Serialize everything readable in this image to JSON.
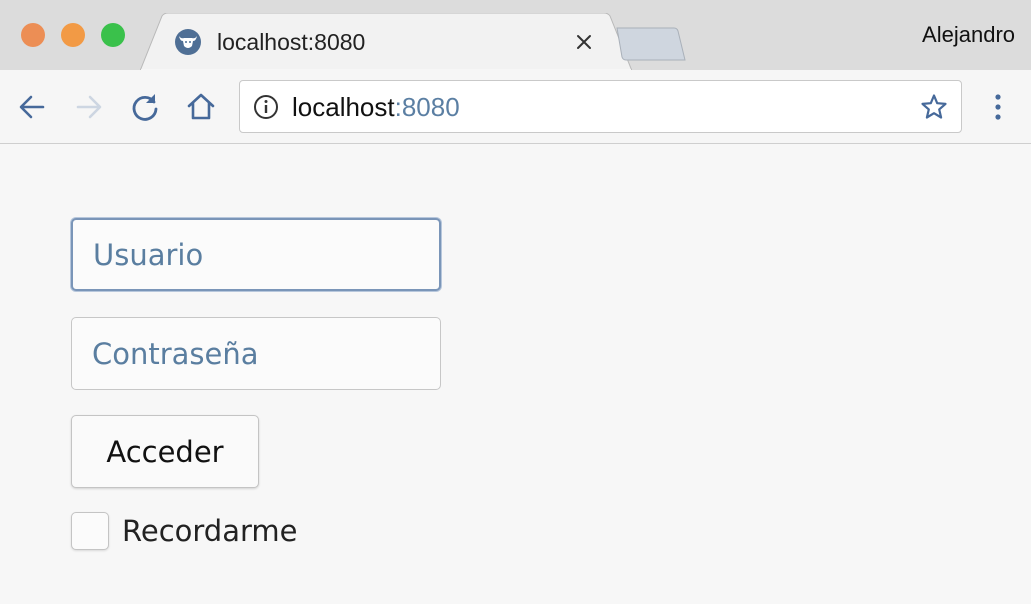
{
  "window": {
    "profile_name": "Alejandro",
    "traffic_lights": {
      "close_color": "#ec8e55",
      "minimize_color": "#f29a45",
      "zoom_color": "#3ac14b"
    }
  },
  "tab": {
    "title": "localhost:8080",
    "favicon": "bull-logo-icon",
    "close_icon": "close-icon"
  },
  "toolbar": {
    "back_icon": "arrow-left-icon",
    "forward_icon": "arrow-right-icon",
    "reload_icon": "reload-icon",
    "home_icon": "home-icon",
    "menu_icon": "more-vertical-icon"
  },
  "omnibox": {
    "info_icon": "info-icon",
    "url_host": "localhost",
    "url_port": ":8080",
    "bookmark_icon": "star-icon"
  },
  "login_form": {
    "username_placeholder": "Usuario",
    "username_value": "",
    "password_placeholder": "Contraseña",
    "password_value": "",
    "submit_label": "Acceder",
    "remember_label": "Recordarme",
    "remember_checked": false
  },
  "colors": {
    "accent": "#5a7ea0",
    "focus_border": "#7a95b8"
  }
}
